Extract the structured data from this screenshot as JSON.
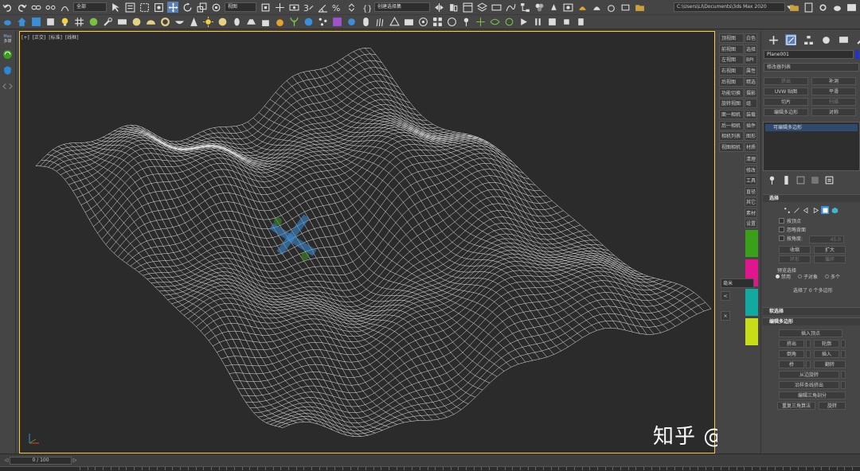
{
  "toolbar": {
    "selection_filter": "全部",
    "view_dropdown": "视图",
    "named_selection": "创建选择集",
    "project_path": "C:\\Users\\LI\\Documents\\3ds Max 2020",
    "spinner_value": "3"
  },
  "left_strip": {
    "label_top": "Max",
    "label_bottom": "多媒"
  },
  "viewport": {
    "label_plus": "[+]",
    "label_view": "[正交]",
    "label_shading": "[标准]",
    "label_wire": "[线框]"
  },
  "watermark": {
    "text": "知乎 @源海广筑"
  },
  "view_buttons": [
    {
      "label": "顶视图",
      "side": "白色"
    },
    {
      "label": "前视图",
      "side": "选择"
    },
    {
      "label": "左视图",
      "side": "BPI"
    },
    {
      "label": "右视图",
      "side": "属性"
    },
    {
      "label": "后视图",
      "side": "精选"
    },
    {
      "label": "功能切换",
      "side": "摄影"
    },
    {
      "label": "旋转视图",
      "side": "组"
    },
    {
      "label": "面一相机",
      "side": "装载"
    },
    {
      "label": "后一相机",
      "side": "插件"
    },
    {
      "label": "相机列表",
      "side": "图形"
    },
    {
      "label": "视图相机",
      "side": "材质"
    }
  ],
  "side_column_extra": [
    "清理",
    "修改",
    "工具",
    "直径",
    "其它",
    "素材",
    "设置"
  ],
  "units_dropdown": "毫米",
  "colors": {
    "accent_blue": "#2233cc",
    "block_green": "#3aa01a",
    "block_magenta": "#e0168c",
    "block_teal": "#11a9a0",
    "block_lime": "#c8dc17",
    "viewport_border": "#ffcc33"
  },
  "command_panel": {
    "object_name": "Plane001",
    "modifier_list": "修改器列表",
    "mod_buttons": [
      {
        "label": "挤出",
        "dim": true
      },
      {
        "label": "补洞",
        "dim": false
      },
      {
        "label": "UVW 贴图",
        "dim": false
      },
      {
        "label": "平滑",
        "dim": false
      },
      {
        "label": "切片",
        "dim": false
      },
      {
        "label": "扫描",
        "dim": true
      },
      {
        "label": "编辑多边形",
        "dim": false
      },
      {
        "label": "对称",
        "dim": false
      }
    ],
    "stack_item": "可编辑多边形",
    "selection_header": "选择",
    "options": {
      "by_vertex": "按顶点",
      "ignore_back": "忽略背面",
      "by_angle": "按角度:",
      "angle_value": "45.0",
      "shrink": "收缩",
      "grow": "扩大",
      "ring": "环形",
      "loop": "循环",
      "preview_label": "预览选择",
      "preview_off": "禁用",
      "preview_sub": "子对象",
      "preview_multi": "多个",
      "selected_text": "选择了 0 个多边形"
    },
    "soft_selection_header": "软选择",
    "edit_poly_header": "编辑多边形",
    "edit_buttons": {
      "insert_vertex": "插入顶点",
      "extrude": "挤出",
      "outline": "轮廓",
      "bevel": "倒角",
      "inset": "插入",
      "bridge": "桥",
      "flip": "翻转",
      "hinge": "从边旋转",
      "extrude_spline": "沿样条线挤出",
      "edit_tri": "编辑三角剖分",
      "retriangulate": "重复三角算法",
      "turn": "旋转"
    }
  },
  "timeline": {
    "frame": "0 / 100"
  }
}
